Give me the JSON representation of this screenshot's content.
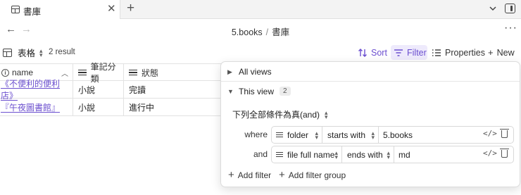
{
  "tab": {
    "title": "書庫",
    "close": "✕",
    "new_tab": "+"
  },
  "nav": {
    "back": "←",
    "forward": "→",
    "folder": "5.books",
    "separator": "/",
    "file": "書庫",
    "more": "···"
  },
  "toolbar": {
    "view_name": "表格",
    "result_count": "2 result",
    "sort_label": "Sort",
    "filter_label": "Filter",
    "properties_label": "Properties",
    "new_label": "New",
    "accent_color": "#6b4fcf"
  },
  "table": {
    "columns": [
      {
        "label": "name"
      },
      {
        "label": "筆記分類"
      },
      {
        "label": "狀態"
      }
    ],
    "rows": [
      {
        "name": "《不便利的便利店》",
        "category": "小說",
        "status": "完讀"
      },
      {
        "name": "『午夜圖書館』",
        "category": "小說",
        "status": "進行中"
      }
    ]
  },
  "filter_panel": {
    "all_views_label": "All views",
    "this_view_label": "This view",
    "this_view_count": "2",
    "conjunction": "下列全部條件為真(and)",
    "filters": [
      {
        "prefix": "where",
        "property": "folder",
        "operator": "starts with",
        "value": "5.books"
      },
      {
        "prefix": "and",
        "property": "file full name",
        "operator": "ends with",
        "value": "md"
      }
    ],
    "add_filter_label": "Add filter",
    "add_group_label": "Add filter group"
  }
}
